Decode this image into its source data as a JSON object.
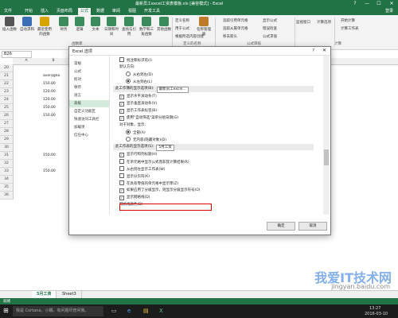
{
  "window": {
    "title": "最新员工excel工资表模板.xls [兼容模式] - Excel",
    "controls": [
      "?",
      "—",
      "☐",
      "✕"
    ]
  },
  "ribbon": {
    "tabs": [
      "文件",
      "开始",
      "插入",
      "页面布局",
      "公式",
      "数据",
      "审阅",
      "视图",
      "开发工具"
    ],
    "active_tab": "公式",
    "login": "登录",
    "buttons": [
      {
        "label": "插入函数",
        "icon": "fx-icon",
        "color": "#555555"
      },
      {
        "label": "自动求和",
        "icon": "sum-icon",
        "color": "#3a6fb5"
      },
      {
        "label": "最近使用的函数",
        "icon": "star-icon",
        "color": "#d9a400"
      },
      {
        "label": "财务",
        "icon": "book-icon",
        "color": "#3a8c5a"
      },
      {
        "label": "逻辑",
        "icon": "book-icon",
        "color": "#3a8c5a"
      },
      {
        "label": "文本",
        "icon": "book-icon",
        "color": "#3a8c5a"
      },
      {
        "label": "日期和时间",
        "icon": "clock-icon",
        "color": "#3a8c5a"
      },
      {
        "label": "查找与引用",
        "icon": "book-icon",
        "color": "#3a8c5a"
      },
      {
        "label": "数学和三角函数",
        "icon": "book-icon",
        "color": "#3a8c5a"
      },
      {
        "label": "其他函数",
        "icon": "book-icon",
        "color": "#3a8c5a"
      },
      {
        "label": "名称管理器",
        "icon": "tag-icon",
        "color": "#c07b2a"
      }
    ],
    "small_buttons": [
      "定义名称",
      "用于公式",
      "根据所选内容创建",
      "追踪引用单元格",
      "追踪从属单元格",
      "移去箭头",
      "显示公式",
      "错误检查",
      "公式求值",
      "监视窗口",
      "计算选项",
      "开始计算",
      "计算工作表"
    ],
    "groups": [
      "函数库",
      "定义的名称",
      "公式审核",
      "计算"
    ]
  },
  "formula_bar": {
    "name_box": "B26"
  },
  "sheet": {
    "columns": [
      "A",
      "B",
      "C"
    ],
    "rows": [
      "20",
      "21",
      "22",
      "23",
      "24",
      "25",
      "26",
      "27",
      "28",
      "29",
      "30",
      "31",
      "32",
      "33",
      "34",
      "35",
      "36"
    ],
    "cells": [
      {
        "row": 1,
        "text": "averagea"
      },
      {
        "row": 2,
        "text": "150.00"
      },
      {
        "row": 3,
        "text": "120.00"
      },
      {
        "row": 4,
        "text": "120.00"
      },
      {
        "row": 5,
        "text": "150.00"
      },
      {
        "row": 6,
        "text": "150.00"
      },
      {
        "row": 11,
        "text": "150.00"
      },
      {
        "row": 13,
        "text": "150.00"
      }
    ],
    "tabs": [
      "5月工资",
      "Sheet3"
    ],
    "active_tab": "5月工资"
  },
  "status": {
    "text": "就绪"
  },
  "dialog": {
    "title": "Excel 选项",
    "help": "?",
    "close": "✕",
    "nav": [
      "常规",
      "公式",
      "校对",
      "保存",
      "语言",
      "高级",
      "自定义功能区",
      "快速访问工具栏",
      "加载项",
      "信任中心"
    ],
    "selected_nav": "高级",
    "options": [
      {
        "kind": "checkbox",
        "checked": false,
        "label": "批注和标识符(I)"
      },
      {
        "kind": "text",
        "label": "默认方向:"
      },
      {
        "kind": "radio",
        "checked": false,
        "label": "从右到左(D)"
      },
      {
        "kind": "radio",
        "checked": true,
        "label": "从左到右(L)"
      },
      {
        "kind": "section",
        "label": "此工作簿的显示选项(B):",
        "combo": "最新员工excel..."
      },
      {
        "kind": "checkbox",
        "checked": true,
        "label": "显示水平滚动条(T)"
      },
      {
        "kind": "checkbox",
        "checked": true,
        "label": "显示垂直滚动条(V)"
      },
      {
        "kind": "checkbox",
        "checked": true,
        "label": "显示工作表标签(B)"
      },
      {
        "kind": "checkbox",
        "checked": true,
        "label": "使用\"自动筛选\"菜单分组日期(G)"
      },
      {
        "kind": "text",
        "label": "对于对象，显示:"
      },
      {
        "kind": "radio",
        "checked": true,
        "label": "全部(A)"
      },
      {
        "kind": "radio",
        "checked": false,
        "label": "无内容(隐藏对象)(D)"
      },
      {
        "kind": "section",
        "label": "此工作表的显示选项(S):",
        "combo": "5月工资"
      },
      {
        "kind": "checkbox",
        "checked": true,
        "label": "显示行和列标题(H)"
      },
      {
        "kind": "checkbox",
        "checked": false,
        "label": "在单元格中显示公式而非其计算结果(R)"
      },
      {
        "kind": "checkbox",
        "checked": false,
        "label": "从右到左显示工作表(W)"
      },
      {
        "kind": "checkbox",
        "checked": false,
        "label": "显示分页符(K)"
      },
      {
        "kind": "checkbox",
        "checked": false,
        "label": "在具有零值的单元格中显示零(Z)"
      },
      {
        "kind": "checkbox",
        "checked": true,
        "label": "如果应用了分级显示，则显示分级显示符号(O)"
      },
      {
        "kind": "checkbox",
        "checked": true,
        "label": "显示网格线(D)"
      },
      {
        "kind": "text",
        "label": "网格线颜色(D)"
      }
    ],
    "ok": "确定",
    "cancel": "取消",
    "highlight_color": "#e00000"
  },
  "taskbar": {
    "search_placeholder": "我是 Cortana，小娜。有问题尽管问我。",
    "time": "13:27",
    "date": "2016-03-10"
  },
  "watermark": {
    "text": "我爱IT技术网",
    "url": "jingyan.baidu.com"
  },
  "colors": {
    "excel_green": "#217346",
    "selected_nav": "#d3ecdb"
  }
}
